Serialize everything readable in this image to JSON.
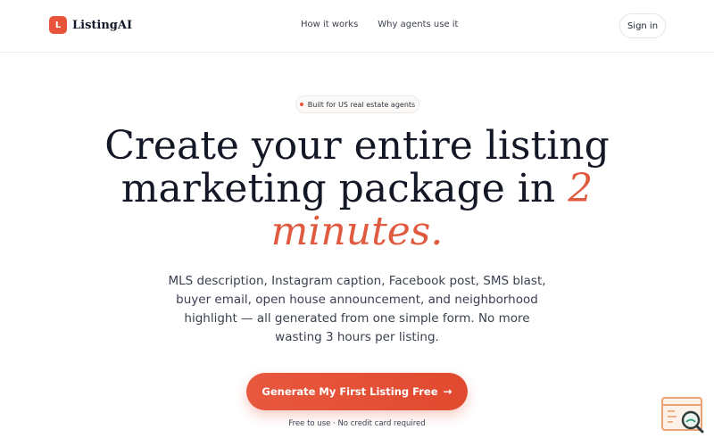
{
  "nav": {
    "logo_letter": "L",
    "brand": "ListingAI",
    "links": [
      "How it works",
      "Why agents use it"
    ],
    "signin_label": "Sign in"
  },
  "hero": {
    "badge": "Built for US real estate agents",
    "headline_main": "Create your entire listing marketing package in",
    "headline_accent": "2 minutes.",
    "subtext": "MLS description, Instagram caption, Facebook post, SMS blast, buyer email, open house announcement, and neighborhood highlight — all generated from one simple form. No more wasting 3 hours per listing.",
    "cta_label": "Generate My First Listing Free",
    "cta_icon": "arrow-right-icon",
    "note": "Free to use · No credit card required"
  },
  "colors": {
    "accent": "#e7543a",
    "headline": "#131726",
    "body_text": "#3b4050"
  },
  "widget": {
    "icon": "search-document-icon"
  }
}
